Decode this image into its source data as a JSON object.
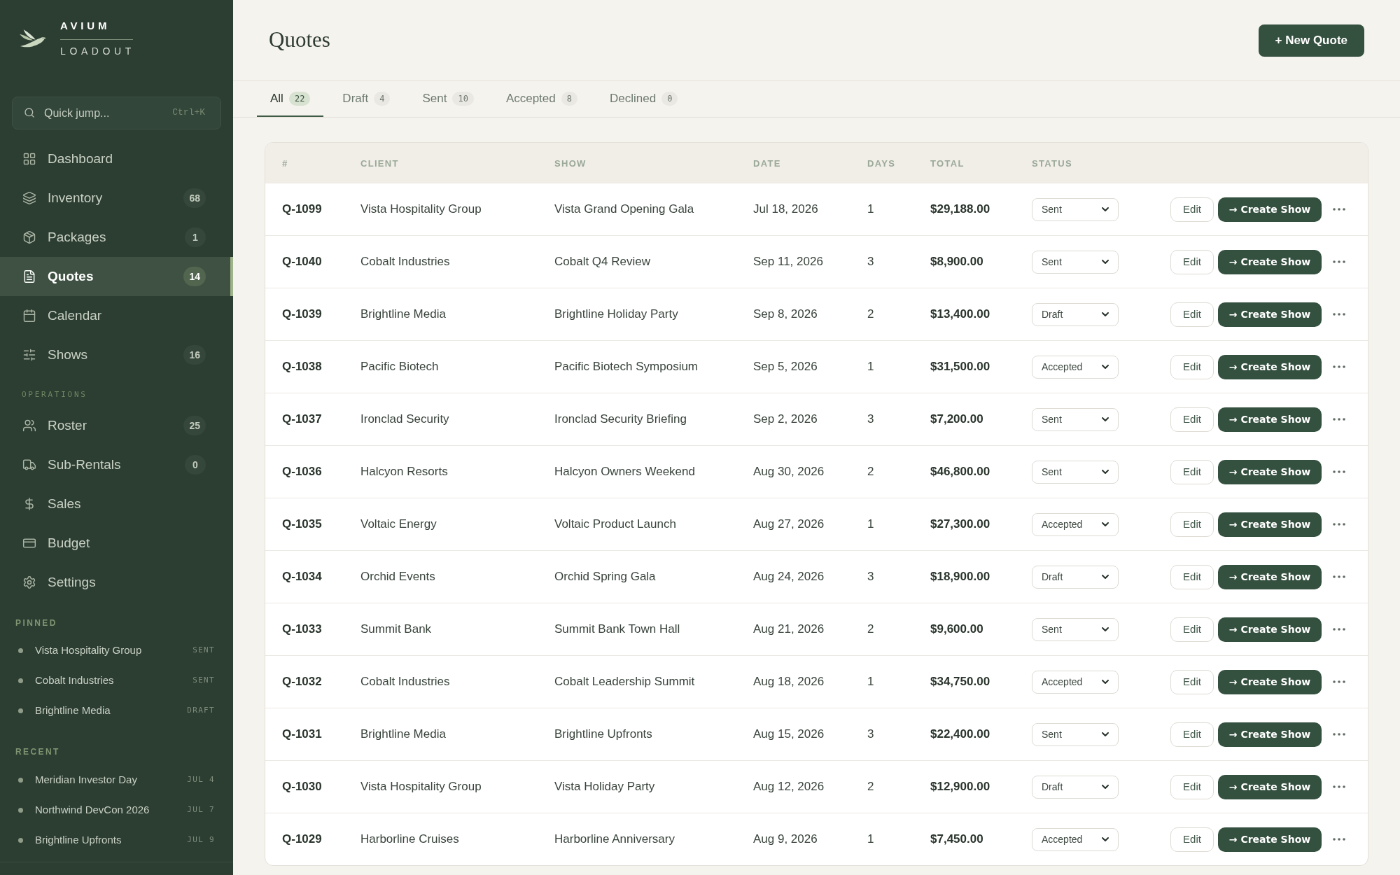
{
  "sidebar": {
    "brand": {
      "name": "AVIUM",
      "subtitle": "LOADOUT"
    },
    "search": {
      "placeholder": "Quick jump...",
      "shortcut": "Ctrl+K"
    },
    "nav": [
      {
        "label": "Dashboard",
        "selected": false
      },
      {
        "label": "Inventory",
        "badge": "68",
        "selected": false
      },
      {
        "label": "Packages",
        "badge": "1",
        "selected": false
      },
      {
        "label": "Quotes",
        "badge": "14",
        "selected": true
      },
      {
        "label": "Calendar",
        "selected": false
      },
      {
        "label": "Shows",
        "badge": "16",
        "selected": false
      }
    ],
    "operations": {
      "title": "OPERATIONS",
      "items": [
        {
          "label": "Roster",
          "badge": "25",
          "selected": false
        },
        {
          "label": "Sub-Rentals",
          "badge": "0",
          "selected": false
        },
        {
          "label": "Sales",
          "selected": false
        },
        {
          "label": "Budget",
          "selected": false
        },
        {
          "label": "Settings",
          "selected": false
        }
      ]
    },
    "pinned": {
      "title": "PINNED",
      "items": [
        {
          "label": "Vista Hospitality Group",
          "tag": "SENT"
        },
        {
          "label": "Cobalt Industries",
          "tag": "SENT"
        },
        {
          "label": "Brightline Media",
          "tag": "DRAFT"
        }
      ]
    },
    "recent": {
      "title": "RECENT",
      "items": [
        {
          "label": "Meridian Investor Day",
          "tag": "JUL 4"
        },
        {
          "label": "Northwind DevCon 2026",
          "tag": "JUL 7"
        },
        {
          "label": "Brightline Upfronts",
          "tag": "JUL 9"
        }
      ]
    }
  },
  "header": {
    "title": "Quotes",
    "new_button": "+ New Quote"
  },
  "tabs": [
    {
      "label": "All",
      "count": "22",
      "selected": true
    },
    {
      "label": "Draft",
      "count": "4",
      "selected": false
    },
    {
      "label": "Sent",
      "count": "10",
      "selected": false
    },
    {
      "label": "Accepted",
      "count": "8",
      "selected": false
    },
    {
      "label": "Declined",
      "count": "0",
      "selected": false
    }
  ],
  "table": {
    "columns": [
      "#",
      "CLIENT",
      "SHOW",
      "DATE",
      "DAYS",
      "TOTAL",
      "STATUS"
    ],
    "rows": [
      {
        "id": "Q-1099",
        "client": "Vista Hospitality Group",
        "show": "Vista Grand Opening Gala",
        "date": "Jul 18, 2026",
        "days": "1",
        "total": "$29,188.00",
        "status": "Sent",
        "edit_label": "Edit",
        "create_label": "→ Create Show"
      },
      {
        "id": "Q-1040",
        "client": "Cobalt Industries",
        "show": "Cobalt Q4 Review",
        "date": "Sep 11, 2026",
        "days": "3",
        "total": "$8,900.00",
        "status": "Sent",
        "edit_label": "Edit",
        "create_label": "→ Create Show"
      },
      {
        "id": "Q-1039",
        "client": "Brightline Media",
        "show": "Brightline Holiday Party",
        "date": "Sep 8, 2026",
        "days": "2",
        "total": "$13,400.00",
        "status": "Draft",
        "edit_label": "Edit",
        "create_label": "→ Create Show"
      },
      {
        "id": "Q-1038",
        "client": "Pacific Biotech",
        "show": "Pacific Biotech Symposium",
        "date": "Sep 5, 2026",
        "days": "1",
        "total": "$31,500.00",
        "status": "Accepted",
        "edit_label": "Edit",
        "create_label": "→ Create Show"
      },
      {
        "id": "Q-1037",
        "client": "Ironclad Security",
        "show": "Ironclad Security Briefing",
        "date": "Sep 2, 2026",
        "days": "3",
        "total": "$7,200.00",
        "status": "Sent",
        "edit_label": "Edit",
        "create_label": "→ Create Show"
      },
      {
        "id": "Q-1036",
        "client": "Halcyon Resorts",
        "show": "Halcyon Owners Weekend",
        "date": "Aug 30, 2026",
        "days": "2",
        "total": "$46,800.00",
        "status": "Sent",
        "edit_label": "Edit",
        "create_label": "→ Create Show"
      },
      {
        "id": "Q-1035",
        "client": "Voltaic Energy",
        "show": "Voltaic Product Launch",
        "date": "Aug 27, 2026",
        "days": "1",
        "total": "$27,300.00",
        "status": "Accepted",
        "edit_label": "Edit",
        "create_label": "→ Create Show"
      },
      {
        "id": "Q-1034",
        "client": "Orchid Events",
        "show": "Orchid Spring Gala",
        "date": "Aug 24, 2026",
        "days": "3",
        "total": "$18,900.00",
        "status": "Draft",
        "edit_label": "Edit",
        "create_label": "→ Create Show"
      },
      {
        "id": "Q-1033",
        "client": "Summit Bank",
        "show": "Summit Bank Town Hall",
        "date": "Aug 21, 2026",
        "days": "2",
        "total": "$9,600.00",
        "status": "Sent",
        "edit_label": "Edit",
        "create_label": "→ Create Show"
      },
      {
        "id": "Q-1032",
        "client": "Cobalt Industries",
        "show": "Cobalt Leadership Summit",
        "date": "Aug 18, 2026",
        "days": "1",
        "total": "$34,750.00",
        "status": "Accepted",
        "edit_label": "Edit",
        "create_label": "→ Create Show"
      },
      {
        "id": "Q-1031",
        "client": "Brightline Media",
        "show": "Brightline Upfronts",
        "date": "Aug 15, 2026",
        "days": "3",
        "total": "$22,400.00",
        "status": "Sent",
        "edit_label": "Edit",
        "create_label": "→ Create Show"
      },
      {
        "id": "Q-1030",
        "client": "Vista Hospitality Group",
        "show": "Vista Holiday Party",
        "date": "Aug 12, 2026",
        "days": "2",
        "total": "$12,900.00",
        "status": "Draft",
        "edit_label": "Edit",
        "create_label": "→ Create Show"
      },
      {
        "id": "Q-1029",
        "client": "Harborline Cruises",
        "show": "Harborline Anniversary",
        "date": "Aug 9, 2026",
        "days": "1",
        "total": "$7,450.00",
        "status": "Accepted",
        "edit_label": "Edit",
        "create_label": "→ Create Show"
      }
    ]
  }
}
